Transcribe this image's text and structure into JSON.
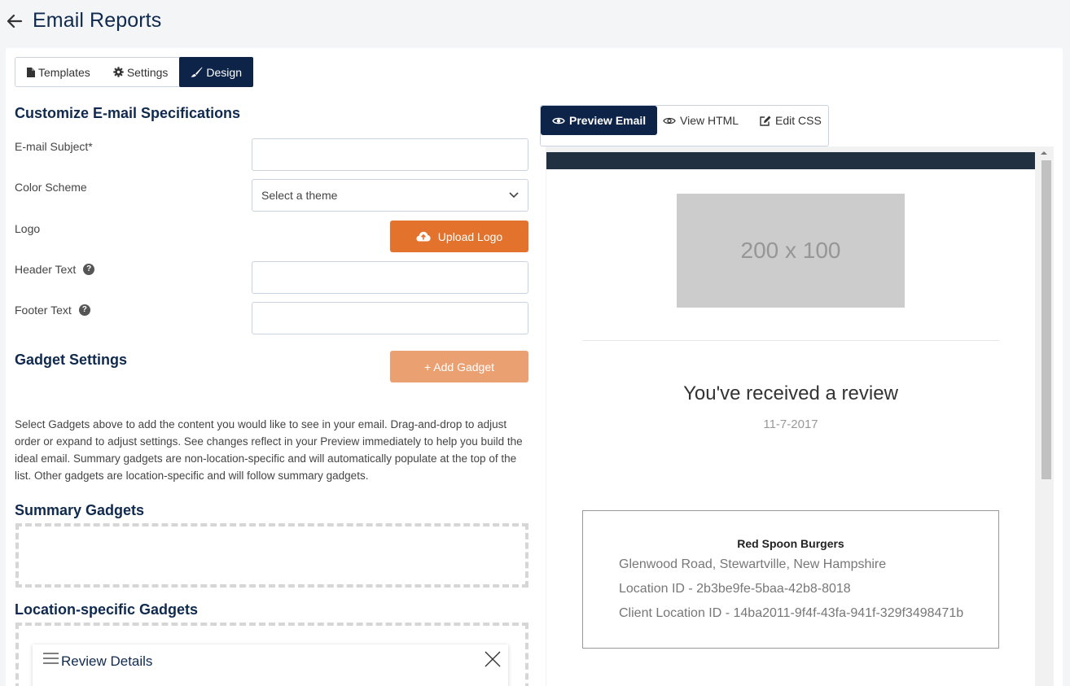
{
  "header": {
    "title": "Email Reports"
  },
  "tabs": {
    "templates": "Templates",
    "settings": "Settings",
    "design": "Design"
  },
  "customize": {
    "title": "Customize E-mail Specifications",
    "subject_label": "E-mail Subject*",
    "subject_value": "",
    "color_scheme_label": "Color Scheme",
    "color_scheme_value": "Select a theme",
    "logo_label": "Logo",
    "upload_logo": "Upload Logo",
    "header_text_label": "Header Text",
    "header_text_value": "",
    "footer_text_label": "Footer Text",
    "footer_text_value": ""
  },
  "gadgets": {
    "title": "Gadget Settings",
    "add_button": "+ Add Gadget",
    "description": "Select Gadgets above to add the content you would like to see in your email. Drag-and-drop to adjust order or expand to adjust settings. See changes reflect in your Preview immediately to help you build the ideal email. Summary gadgets are non-location-specific and will automatically populate at the top of the list. Other gadgets are location-specific and will follow summary gadgets.",
    "summary_title": "Summary Gadgets",
    "location_title": "Location-specific Gadgets",
    "items": [
      {
        "name": "Review Details"
      }
    ]
  },
  "preview": {
    "tabs": {
      "preview": "Preview Email",
      "html": "View HTML",
      "css": "Edit CSS"
    },
    "logo_placeholder": "200 x 100",
    "heading": "You've received a review",
    "date": "11-7-2017",
    "location": {
      "name": "Red Spoon Burgers",
      "address": "Glenwood Road, Stewartville, New Hampshire",
      "location_id": "Location ID - 2b3be9fe-5baa-42b8-8018",
      "client_location_id": "Client Location ID - 14ba2011-9f4f-43fa-941f-329f3498471b"
    }
  },
  "colors": {
    "navy": "#0d2348",
    "orange": "#e2722c",
    "orange_light": "#eba071",
    "email_header": "#213142"
  }
}
